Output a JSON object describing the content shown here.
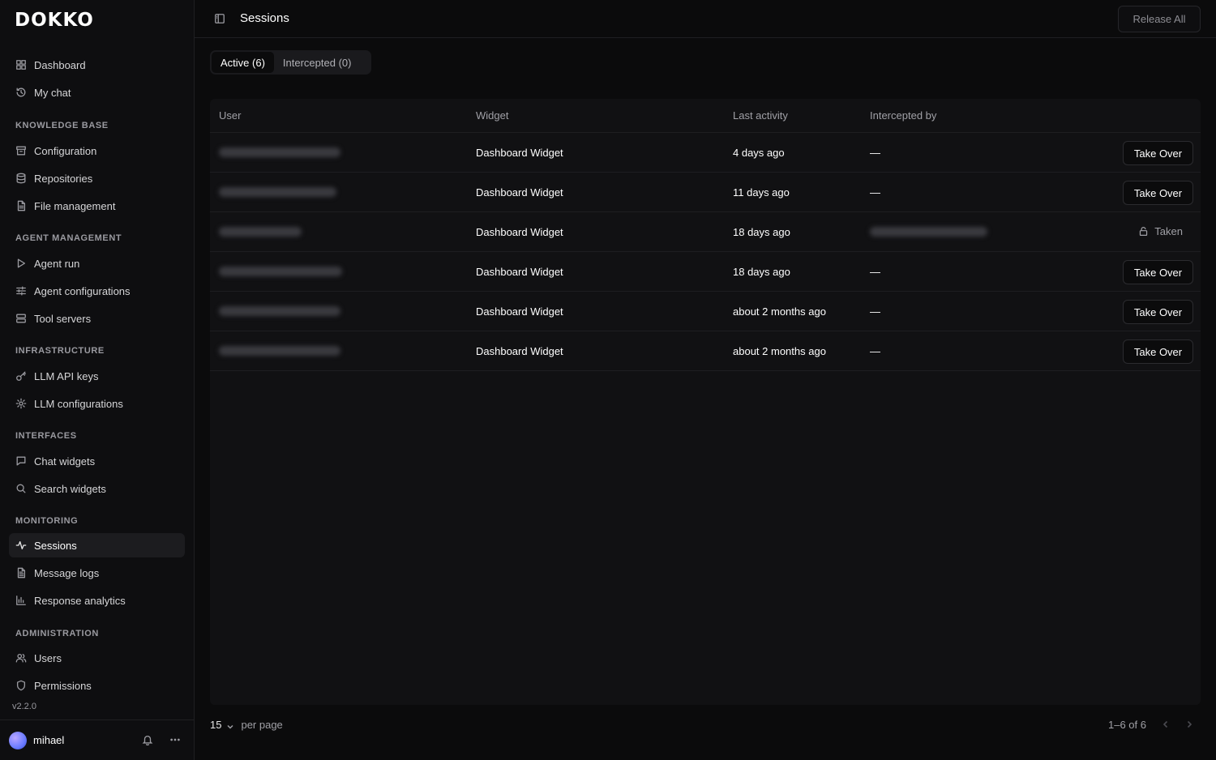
{
  "app": {
    "logo": "DOKKO",
    "version": "v2.2.0"
  },
  "sidebar": {
    "top_items": [
      {
        "label": "Dashboard",
        "icon": "grid-icon"
      },
      {
        "label": "My chat",
        "icon": "history-icon"
      }
    ],
    "sections": [
      {
        "label": "KNOWLEDGE BASE",
        "items": [
          {
            "label": "Configuration",
            "icon": "archive-icon"
          },
          {
            "label": "Repositories",
            "icon": "database-icon"
          },
          {
            "label": "File management",
            "icon": "file-icon"
          }
        ]
      },
      {
        "label": "AGENT MANAGEMENT",
        "items": [
          {
            "label": "Agent run",
            "icon": "play-icon"
          },
          {
            "label": "Agent configurations",
            "icon": "sliders-icon"
          },
          {
            "label": "Tool servers",
            "icon": "server-icon"
          }
        ]
      },
      {
        "label": "INFRASTRUCTURE",
        "items": [
          {
            "label": "LLM API keys",
            "icon": "key-icon"
          },
          {
            "label": "LLM configurations",
            "icon": "gear-icon"
          }
        ]
      },
      {
        "label": "INTERFACES",
        "items": [
          {
            "label": "Chat widgets",
            "icon": "message-icon"
          },
          {
            "label": "Search widgets",
            "icon": "search-icon"
          }
        ]
      },
      {
        "label": "MONITORING",
        "items": [
          {
            "label": "Sessions",
            "icon": "activity-icon",
            "active": true
          },
          {
            "label": "Message logs",
            "icon": "file-text-icon"
          },
          {
            "label": "Response analytics",
            "icon": "bar-chart-icon"
          }
        ]
      },
      {
        "label": "ADMINISTRATION",
        "items": [
          {
            "label": "Users",
            "icon": "users-icon"
          },
          {
            "label": "Permissions",
            "icon": "shield-icon"
          }
        ]
      }
    ]
  },
  "user": {
    "name": "mihael"
  },
  "header": {
    "title": "Sessions",
    "release_all": "Release All"
  },
  "tabs": [
    {
      "label": "Active (6)",
      "active": true
    },
    {
      "label": "Intercepted (0)",
      "active": false
    }
  ],
  "table": {
    "columns": [
      "User",
      "Widget",
      "Last activity",
      "Intercepted by"
    ],
    "rows": [
      {
        "widget": "Dashboard Widget",
        "last_activity": "4 days ago",
        "intercepted_by": "—",
        "action": "Take Over"
      },
      {
        "widget": "Dashboard Widget",
        "last_activity": "11 days ago",
        "intercepted_by": "—",
        "action": "Take Over"
      },
      {
        "widget": "Dashboard Widget",
        "last_activity": "18 days ago",
        "intercepted_by": "",
        "action": "Taken"
      },
      {
        "widget": "Dashboard Widget",
        "last_activity": "18 days ago",
        "intercepted_by": "—",
        "action": "Take Over"
      },
      {
        "widget": "Dashboard Widget",
        "last_activity": "about 2 months ago",
        "intercepted_by": "—",
        "action": "Take Over"
      },
      {
        "widget": "Dashboard Widget",
        "last_activity": "about 2 months ago",
        "intercepted_by": "—",
        "action": "Take Over"
      }
    ]
  },
  "pagination": {
    "per_page": "15",
    "per_page_label": "per page",
    "range": "1–6 of 6"
  },
  "colors": {
    "background": "#0b0b0c",
    "sidebar": "#0e0e10",
    "active_item": "#1c1c1f",
    "text": "#ffffff",
    "muted": "#a0a0a6"
  }
}
